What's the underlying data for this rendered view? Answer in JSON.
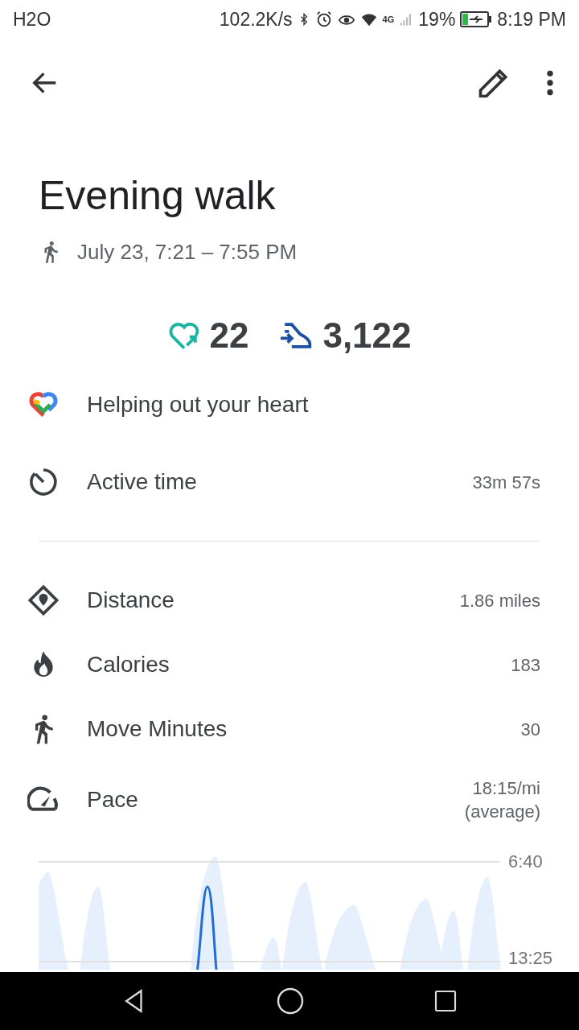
{
  "status_bar": {
    "carrier": "H2O",
    "speed": "102.2K/s",
    "network": "4G",
    "battery": "19%",
    "time": "8:19 PM"
  },
  "activity": {
    "title": "Evening walk",
    "subtitle": "July 23, 7:21 – 7:55 PM"
  },
  "totals": [
    {
      "kind": "heart-points",
      "value": "22",
      "color": "#1ab5a0"
    },
    {
      "kind": "steps",
      "value": "3,122",
      "color": "#1e4fa3"
    }
  ],
  "summary_rows": [
    {
      "kind": "heart",
      "label": "Helping out your heart"
    },
    {
      "kind": "timer",
      "label": "Active time",
      "value": "33m 57s"
    }
  ],
  "stats_rows": [
    {
      "kind": "distance",
      "label": "Distance",
      "value": "1.86 miles"
    },
    {
      "kind": "calories",
      "label": "Calories",
      "value": "183"
    },
    {
      "kind": "walker",
      "label": "Move Minutes",
      "value": "30"
    },
    {
      "kind": "pace",
      "label": "Pace",
      "value": "18:15/mi",
      "note": "(average)"
    }
  ],
  "pace_chart": {
    "axis_labels": [
      "6:40",
      "13:25"
    ]
  }
}
